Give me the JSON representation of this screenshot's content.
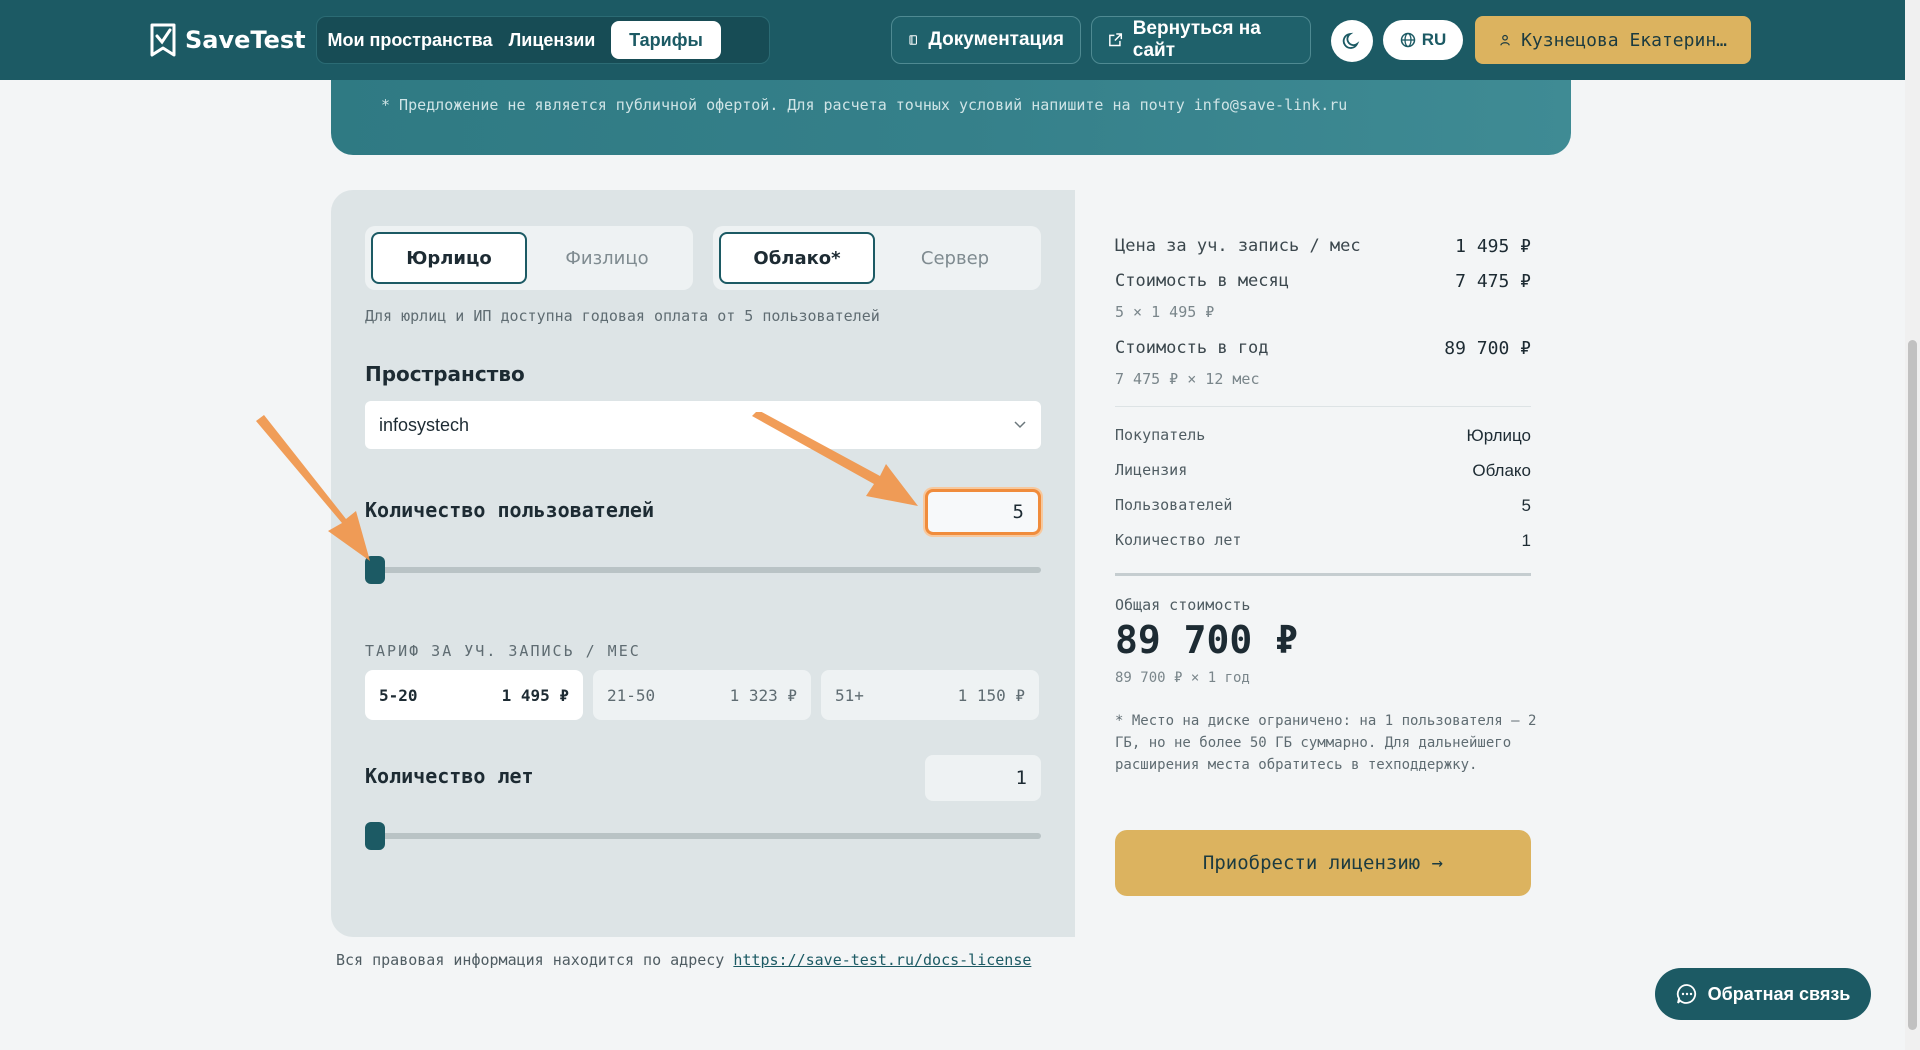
{
  "header": {
    "logo_text": "SaveTest",
    "nav": [
      {
        "label": "Мои пространства",
        "active": false
      },
      {
        "label": "Лицензии",
        "active": false
      },
      {
        "label": "Тарифы",
        "active": true
      }
    ],
    "docs_label": "Документация",
    "back_label": "Вернуться на сайт",
    "lang_label": "RU",
    "user_label": "Кузнецова Екатерин…",
    "theme_icon": "moon-icon"
  },
  "banner": {
    "note": "* Предложение не является публичной офертой. Для расчета точных условий напишите на почту info@save-link.ru"
  },
  "calculator": {
    "buyer_type": {
      "options": [
        "Юрлицо",
        "Физлицо"
      ],
      "selected": "Юрлицо"
    },
    "license_type": {
      "options": [
        "Облако*",
        "Сервер"
      ],
      "selected": "Облако*"
    },
    "hint": "Для юрлиц и ИП доступна годовая оплата от 5 пользователей",
    "space_label": "Пространство",
    "space_value": "infosystech",
    "users_label": "Количество пользователей",
    "users_value": "5",
    "users_slider_fraction": 0,
    "tier_title": "ТАРИФ ЗА УЧ. ЗАПИСЬ / МЕС",
    "tiers": [
      {
        "range": "5-20",
        "price": "1 495 ₽",
        "active": true
      },
      {
        "range": "21-50",
        "price": "1 323 ₽",
        "active": false
      },
      {
        "range": "51+",
        "price": "1 150 ₽",
        "active": false
      }
    ],
    "years_label": "Количество лет",
    "years_value": "1",
    "years_slider_fraction": 0
  },
  "summary": {
    "price_per_user_label": "Цена за уч. запись / мес",
    "price_per_user_value": "1 495 ₽",
    "monthly_label": "Стоимость в месяц",
    "monthly_value": "7 475 ₽",
    "monthly_sub": "5 × 1 495 ₽",
    "yearly_label": "Стоимость в год",
    "yearly_value": "89 700 ₽",
    "yearly_sub": "7 475 ₽ × 12 мес",
    "buyer_label": "Покупатель",
    "buyer_value": "Юрлицо",
    "license_label": "Лицензия",
    "license_value": "Облако",
    "users_label": "Пользователей",
    "users_value": "5",
    "years_label": "Количество лет",
    "years_value": "1",
    "total_label": "Общая стоимость",
    "total_value": "89 700 ₽",
    "total_sub": "89 700 ₽ × 1 год",
    "note": "* Место на диске ограничено: на 1 пользователя – 2 ГБ, но не более 50 ГБ суммарно. Для дальнейшего расширения места обратитесь в техподдержку.",
    "buy_label": "Приобрести лицензию →"
  },
  "footer": {
    "legal_text": "Вся правовая информация находится по адресу",
    "legal_link": "https://save-test.ru/docs-license"
  },
  "feedback_label": "Обратная связь",
  "colors": {
    "header_bg": "#1c5a64",
    "accent_gold": "#dcb35f",
    "highlight_orange": "#f08c3c"
  }
}
